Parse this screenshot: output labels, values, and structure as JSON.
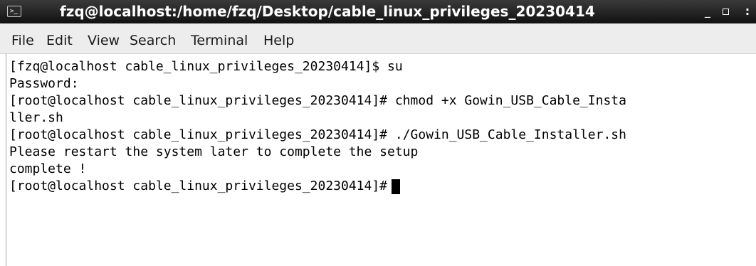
{
  "window": {
    "title": "fzq@localhost:/home/fzq/Desktop/cable_linux_privileges_20230414",
    "icon": "terminal-icon",
    "minimize_glyph": "_",
    "close_glyph": ":"
  },
  "menu": {
    "items": [
      "File",
      "Edit",
      "View",
      "Search",
      "Terminal",
      "Help"
    ]
  },
  "terminal": {
    "lines": [
      "[fzq@localhost cable_linux_privileges_20230414]$ su",
      "Password:",
      "[root@localhost cable_linux_privileges_20230414]# chmod +x Gowin_USB_Cable_Insta",
      "ller.sh",
      "[root@localhost cable_linux_privileges_20230414]# ./Gowin_USB_Cable_Installer.sh",
      "Please restart the system later to complete the setup",
      "complete !",
      "[root@localhost cable_linux_privileges_20230414]#"
    ],
    "colors": {
      "background": "#ffffff",
      "text": "#000000",
      "cursor": "#000000"
    }
  }
}
